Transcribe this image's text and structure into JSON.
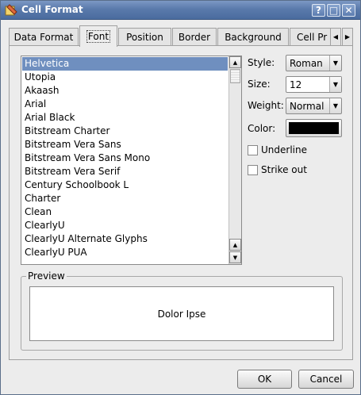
{
  "window": {
    "title": "Cell Format"
  },
  "titlebar_buttons": {
    "help": "?",
    "maximize": "□",
    "close": "✕"
  },
  "tabs": [
    {
      "id": "data-format",
      "label": "Data Format"
    },
    {
      "id": "font",
      "label": "Font",
      "active": true
    },
    {
      "id": "position",
      "label": "Position"
    },
    {
      "id": "border",
      "label": "Border"
    },
    {
      "id": "background",
      "label": "Background"
    },
    {
      "id": "cell-protection",
      "label": "Cell Pr"
    }
  ],
  "font_list": {
    "items": [
      "Helvetica",
      "Utopia",
      "Akaash",
      "Arial",
      "Arial Black",
      "Bitstream Charter",
      "Bitstream Vera Sans",
      "Bitstream Vera Sans Mono",
      "Bitstream Vera Serif",
      "Century Schoolbook L",
      "Charter",
      "Clean",
      "ClearlyU",
      "ClearlyU Alternate Glyphs",
      "ClearlyU PUA"
    ],
    "selected": "Helvetica"
  },
  "properties": {
    "style_label": "Style:",
    "style_value": "Roman",
    "size_label": "Size:",
    "size_value": "12",
    "weight_label": "Weight:",
    "weight_value": "Normal",
    "color_label": "Color:",
    "color_value": "#000000",
    "underline_label": "Underline",
    "underline_checked": false,
    "strikeout_label": "Strike out",
    "strikeout_checked": false
  },
  "preview": {
    "title": "Preview",
    "sample_text": "Dolor Ipse"
  },
  "buttons": {
    "ok": "OK",
    "cancel": "Cancel"
  }
}
